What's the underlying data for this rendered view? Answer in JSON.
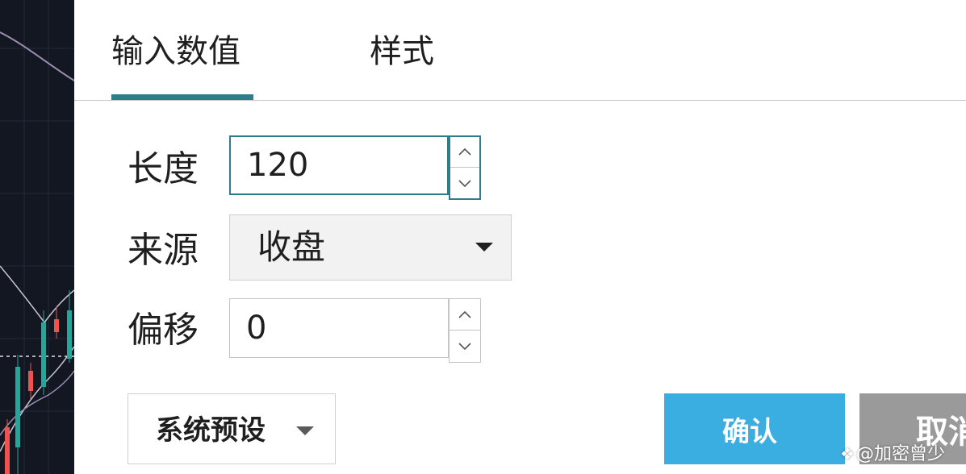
{
  "tabs": [
    {
      "label": "输入数值",
      "active": true
    },
    {
      "label": "样式",
      "active": false
    }
  ],
  "fields": {
    "length": {
      "label": "长度",
      "value": "120"
    },
    "source": {
      "label": "来源",
      "value": "收盘"
    },
    "offset": {
      "label": "偏移",
      "value": "0"
    }
  },
  "buttons": {
    "preset": "系统预设",
    "confirm": "确认",
    "cancel": "取消"
  },
  "watermark": "@加密曾少",
  "colors": {
    "accent": "#2f7d8c",
    "confirm": "#3aaee0",
    "cancel": "#9a9a9a",
    "chart_bg": "#131722",
    "candle_up": "#26a69a",
    "candle_down": "#ef5350"
  },
  "icons": {
    "stepper_up": "chevron-up-icon",
    "stepper_down": "chevron-down-icon",
    "dropdown": "caret-down-icon"
  }
}
